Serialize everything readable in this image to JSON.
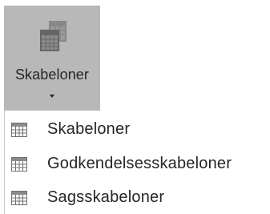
{
  "ribbon": {
    "button_label": "Skabeloner",
    "icon": "templates-icon"
  },
  "menu": {
    "items": [
      {
        "label": "Skabeloner",
        "icon": "template-icon"
      },
      {
        "label": "Godkendelsesskabeloner",
        "icon": "template-icon"
      },
      {
        "label": "Sagsskabeloner",
        "icon": "template-icon"
      }
    ]
  }
}
